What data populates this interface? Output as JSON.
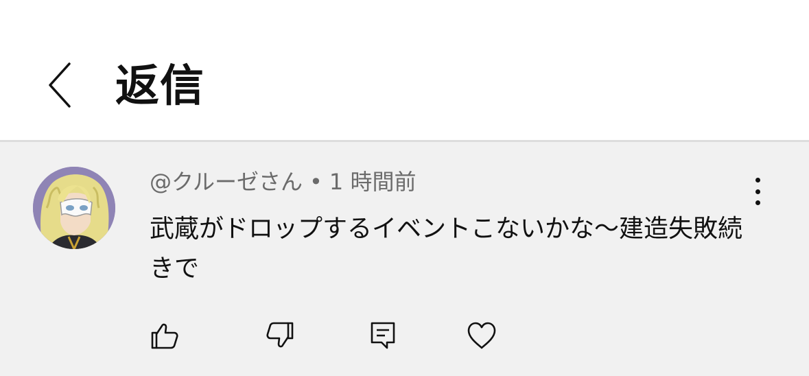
{
  "header": {
    "back_icon": "chevron-left-icon",
    "title": "返信"
  },
  "comment": {
    "avatar_icon": "avatar-image",
    "author": "@クルーゼさん",
    "separator": "•",
    "timestamp": "1 時間前",
    "text": "武蔵がドロップするイベントこないかな〜建造失敗続きで",
    "more_icon": "more-vertical-icon"
  },
  "actions": [
    {
      "icon": "thumbs-up-icon"
    },
    {
      "icon": "thumbs-down-icon"
    },
    {
      "icon": "reply-comment-icon"
    },
    {
      "icon": "heart-icon"
    }
  ],
  "colors": {
    "header_bg": "#ffffff",
    "comment_bg": "#f1f1f1",
    "text_primary": "#111111",
    "text_secondary": "#6b6b6b"
  }
}
